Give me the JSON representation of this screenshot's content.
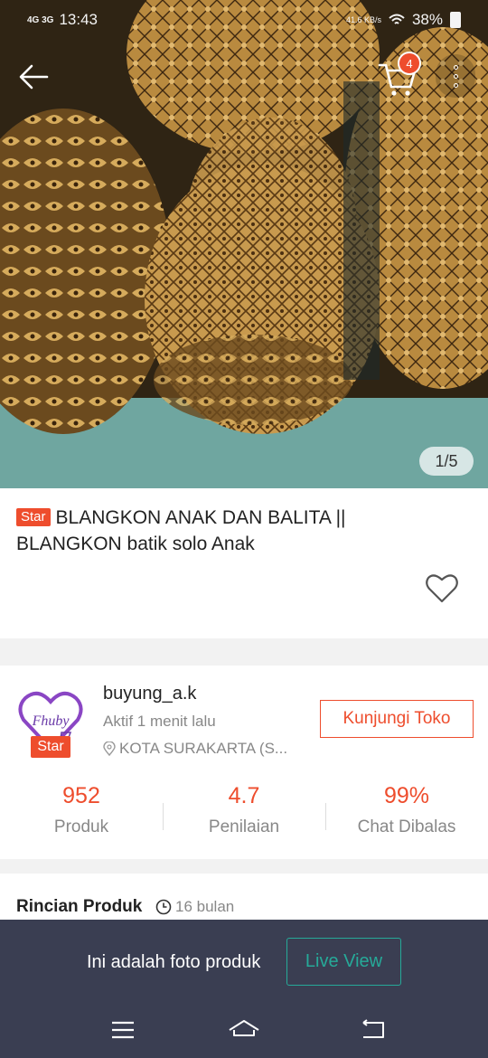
{
  "status_bar": {
    "network": "4G 3G",
    "time": "13:43",
    "net_speed": "41.6 KB/s",
    "battery": "38%"
  },
  "top_nav": {
    "back_icon": "arrow-left-icon",
    "cart_icon": "cart-icon",
    "cart_count": "4",
    "more_icon": "more-vertical-icon"
  },
  "gallery": {
    "pager": "1/5"
  },
  "product": {
    "badge": "Star",
    "title": "BLANGKON ANAK DAN BALITA || BLANGKON batik solo Anak",
    "favorite_icon": "heart-icon"
  },
  "shop": {
    "logo_text": "Fhuby",
    "badge": "Star",
    "name": "buyung_a.k",
    "active": "Aktif 1 menit lalu",
    "location": "KOTA SURAKARTA (S...",
    "visit_button": "Kunjungi Toko",
    "stats": [
      {
        "value": "952",
        "label": "Produk"
      },
      {
        "value": "4.7",
        "label": "Penilaian"
      },
      {
        "value": "99%",
        "label": "Chat Dibalas"
      }
    ]
  },
  "details": {
    "title": "Rincian Produk",
    "time": "16 bulan"
  },
  "overlay": {
    "text": "Ini adalah foto produk",
    "button": "Live View"
  },
  "colors": {
    "accent": "#ee4d2d",
    "live_view": "#26aa99",
    "overlay_bg": "#3a3e52"
  }
}
